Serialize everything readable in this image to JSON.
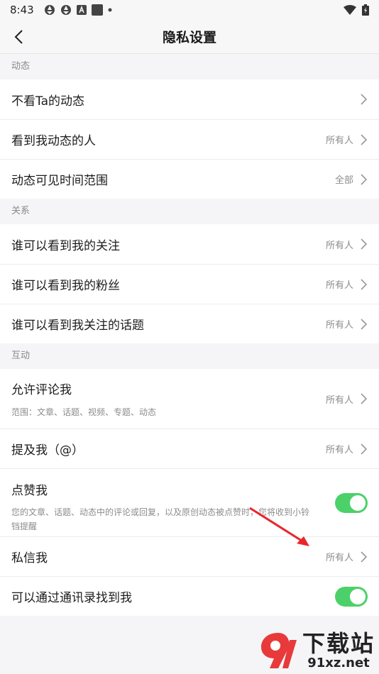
{
  "status_bar": {
    "time": "8:43",
    "left_icons": [
      "aperture-icon",
      "aperture-icon",
      "font-a-icon",
      "square-icon",
      "dot-icon"
    ],
    "right_icons": [
      "wifi-icon",
      "battery-icon"
    ]
  },
  "header": {
    "title": "隐私设置"
  },
  "sections": {
    "dynamic": {
      "header": "动态",
      "items": [
        {
          "label": "不看Ta的动态",
          "value": ""
        },
        {
          "label": "看到我动态的人",
          "value": "所有人"
        },
        {
          "label": "动态可见时间范围",
          "value": "全部"
        }
      ]
    },
    "relation": {
      "header": "关系",
      "items": [
        {
          "label": "谁可以看到我的关注",
          "value": "所有人"
        },
        {
          "label": "谁可以看到我的粉丝",
          "value": "所有人"
        },
        {
          "label": "谁可以看到我关注的话题",
          "value": "所有人"
        }
      ]
    },
    "interact": {
      "header": "互动",
      "allow_comment": {
        "label": "允许评论我",
        "sub": "范围：文章、话题、视频、专题、动态",
        "value": "所有人"
      },
      "mention": {
        "label": "提及我（@）",
        "value": "所有人"
      },
      "like": {
        "label": "点赞我",
        "sub": "您的文章、话题、动态中的评论或回复，以及原创动态被点赞时，您将收到小铃铛提醒",
        "toggle_on": true
      },
      "private_msg": {
        "label": "私信我",
        "value": "所有人"
      },
      "contacts": {
        "label": "可以通过通讯录找到我",
        "toggle_on": true
      }
    }
  },
  "watermark": {
    "big": "下载站",
    "small": "91xz.net"
  },
  "colors": {
    "toggle_on": "#4cd16a",
    "annotation_arrow": "#e8262b",
    "watermark_red": "#e83a3a"
  }
}
